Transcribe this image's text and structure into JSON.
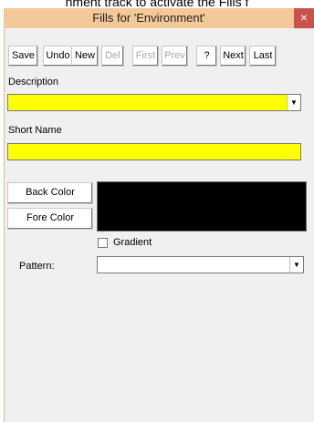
{
  "caption": "nment track to activate the Fills f",
  "window": {
    "title": "Fills for 'Environment'",
    "close_glyph": "×"
  },
  "toolbar": {
    "save": "Save",
    "undo": "Undo",
    "new": "New",
    "del": "Del",
    "first": "First",
    "prev": "Prev",
    "help": "?",
    "next": "Next",
    "last": "Last"
  },
  "form": {
    "description_label": "Description",
    "description_value": "",
    "short_name_label": "Short Name",
    "short_name_value": "",
    "back_color_button": "Back Color",
    "fore_color_button": "Fore Color",
    "fill_color": "#000000",
    "field_highlight": "#ffff00",
    "gradient_label": "Gradient",
    "gradient_checked": false,
    "pattern_label": "Pattern:",
    "pattern_value": ""
  },
  "icons": {
    "dropdown": "chevron-down-icon",
    "close": "close-icon"
  }
}
